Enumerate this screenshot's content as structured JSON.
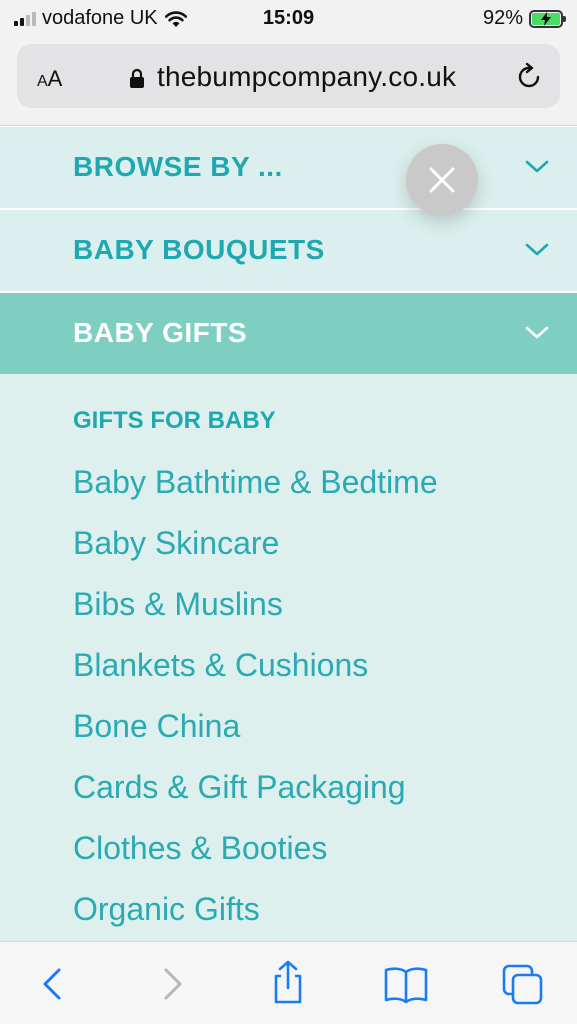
{
  "status_bar": {
    "carrier": "vodafone UK",
    "time": "15:09",
    "battery_percent": "92%",
    "signal_bars": 4,
    "signal_bars_active": 2
  },
  "browser": {
    "text_size_small": "A",
    "text_size_big": "A",
    "url": "thebumpcompany.co.uk"
  },
  "menu": {
    "sections": [
      {
        "label": "BROWSE BY ...",
        "state": "collapsed"
      },
      {
        "label": "BABY BOUQUETS",
        "state": "collapsed"
      },
      {
        "label": "BABY GIFTS",
        "state": "expanded"
      }
    ],
    "subheading": "GIFTS FOR BABY",
    "items": [
      "Baby Bathtime & Bedtime",
      "Baby Skincare",
      "Bibs & Muslins",
      "Blankets & Cushions",
      "Bone China",
      "Cards & Gift Packaging",
      "Clothes & Booties",
      "Organic Gifts"
    ]
  },
  "icons": {
    "close": "close-icon",
    "back": "chevron-left-icon",
    "forward": "chevron-right-icon",
    "share": "share-icon",
    "bookmarks": "book-icon",
    "tabs": "tabs-icon"
  },
  "colors": {
    "accent_teal": "#20a8b0",
    "menu_bg": "#ddf0ed",
    "expanded_bg": "#7ecfc1",
    "ios_blue": "#1a7cf5"
  }
}
